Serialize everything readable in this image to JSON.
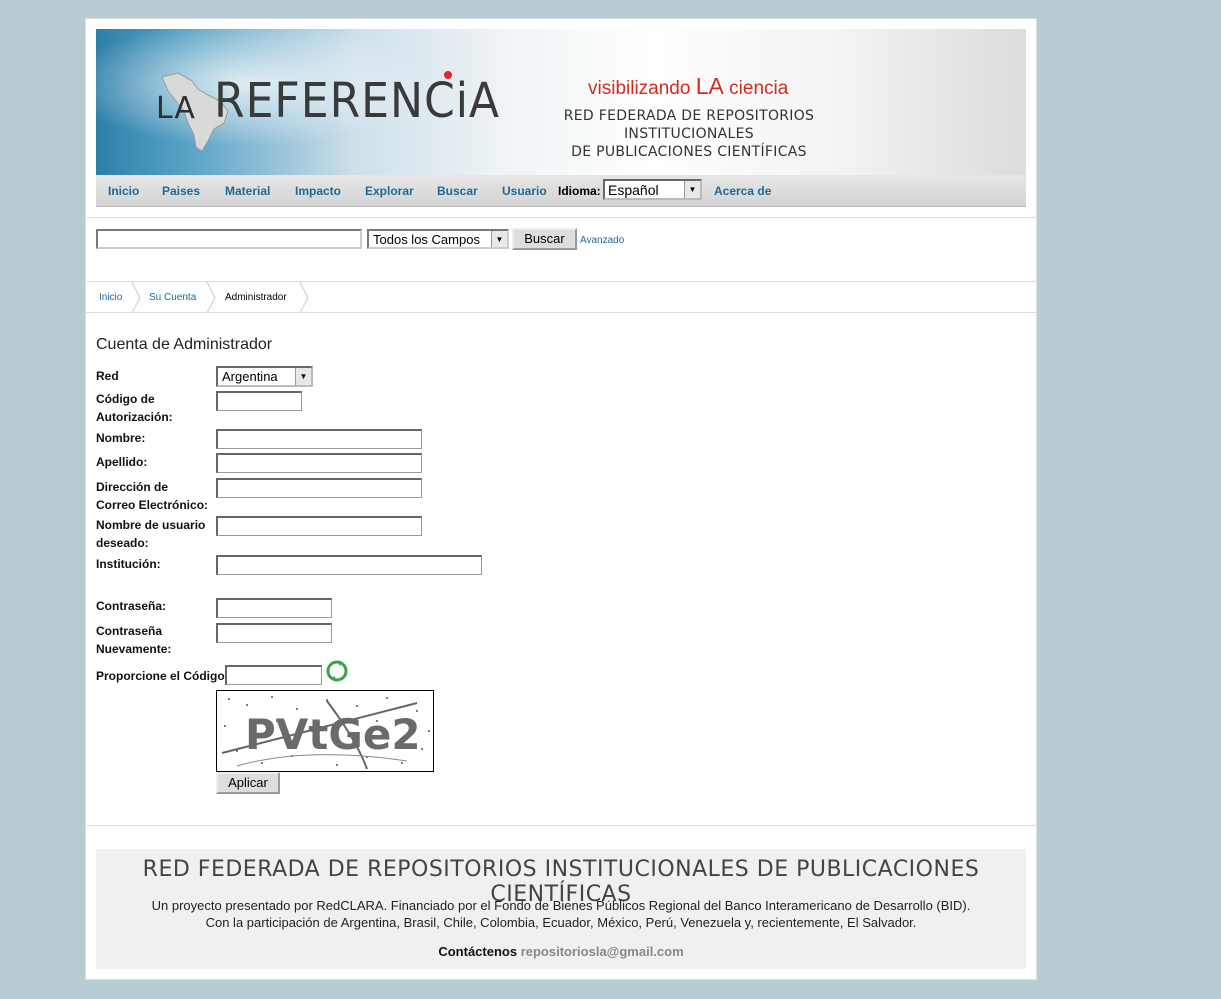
{
  "header": {
    "logo_la": "LA",
    "logo_ref": "REFERENCiA",
    "tagline_pre": "visibilizando ",
    "tagline_la": "LA",
    "tagline_post": " ciencia",
    "subtitle_line1": "RED FEDERADA DE REPOSITORIOS INSTITUCIONALES",
    "subtitle_line2": "DE PUBLICACIONES CIENTÍFICAS"
  },
  "nav": {
    "items": [
      "Inicio",
      "Paises",
      "Material",
      "Impacto",
      "Explorar",
      "Buscar",
      "Usuario"
    ],
    "language_label": "Idioma:",
    "language_value": "Español",
    "about": "Acerca de"
  },
  "search": {
    "query": "",
    "field_select": "Todos los Campos",
    "button": "Buscar",
    "advanced": "Avanzado"
  },
  "breadcrumb": [
    "Inicio",
    "Su Cuenta",
    "Administrador"
  ],
  "form": {
    "title": "Cuenta de Administrador",
    "red_label": "Red",
    "red_value": "Argentina",
    "auth_label_1": "Código de",
    "auth_label_2": "Autorización:",
    "nombre_label": "Nombre:",
    "apellido_label": "Apellido:",
    "email_label_1": "Dirección de",
    "email_label_2": "Correo Electrónico:",
    "user_label_1": "Nombre de usuario",
    "user_label_2": "deseado:",
    "institucion_label": "Institución:",
    "pass_label": "Contraseña:",
    "pass2_label_1": "Contraseña",
    "pass2_label_2": "Nuevamente:",
    "code_label": "Proporcione el Código:",
    "captcha_text": "PVtGe2",
    "apply": "Aplicar"
  },
  "footer": {
    "title": "RED FEDERADA DE REPOSITORIOS INSTITUCIONALES DE PUBLICACIONES CIENTÍFICAS",
    "line1": "Un proyecto presentado por RedCLARA. Financiado por el Fondo de Bienes Públicos Regional del Banco Interamericano de Desarrollo (BID).",
    "line2": "Con la participación de Argentina, Brasil, Chile, Colombia, Ecuador, México, Perú, Venezuela y, recientemente, El Salvador.",
    "contact_label": "Contáctenos",
    "email": "repositoriosla@gmail.com"
  },
  "colors": {
    "background": "#b8ccd4",
    "link": "#1d6a99",
    "tagline_red": "#d62a1e"
  }
}
